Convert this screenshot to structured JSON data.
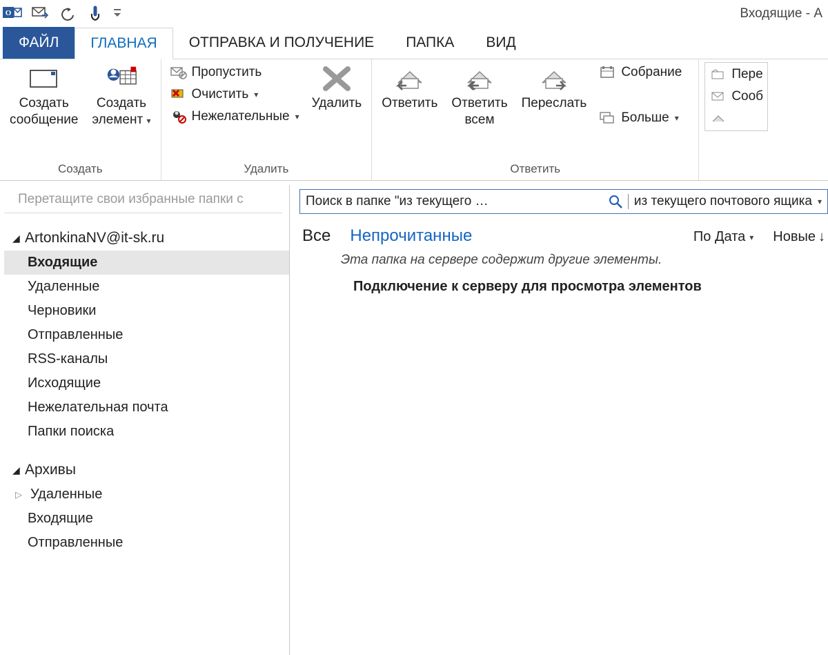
{
  "window_title": "Входящие - A",
  "tabs": {
    "file": "ФАЙЛ",
    "home": "ГЛАВНАЯ",
    "send_receive": "ОТПРАВКА И ПОЛУЧЕНИЕ",
    "folder": "ПАПКА",
    "view": "ВИД"
  },
  "ribbon": {
    "create": {
      "group_label": "Создать",
      "new_mail_top": "Создать",
      "new_mail_bottom": "сообщение",
      "new_item_top": "Создать",
      "new_item_bottom": "элемент"
    },
    "delete": {
      "group_label": "Удалить",
      "ignore": "Пропустить",
      "clean": "Очистить",
      "junk": "Нежелательные",
      "delete": "Удалить"
    },
    "respond": {
      "group_label": "Ответить",
      "reply": "Ответить",
      "reply_all_top": "Ответить",
      "reply_all_bottom": "всем",
      "forward": "Переслать",
      "meeting": "Собрание",
      "more": "Больше"
    },
    "quicksteps": {
      "item1": "Пере",
      "item2": "Сооб"
    }
  },
  "sidebar": {
    "favorites_hint": "Перетащите свои избранные папки с",
    "account": "ArtonkinaNV@it-sk.ru",
    "folders": {
      "inbox": "Входящие",
      "deleted": "Удаленные",
      "drafts": "Черновики",
      "sent": "Отправленные",
      "rss": "RSS-каналы",
      "outbox": "Исходящие",
      "junk": "Нежелательная почта",
      "search_folders": "Папки поиска"
    },
    "archives_label": "Архивы",
    "archives": {
      "deleted": "Удаленные",
      "inbox": "Входящие",
      "sent": "Отправленные"
    }
  },
  "main": {
    "search_placeholder": "Поиск в папке \"из текущего …",
    "search_scope": "из текущего почтового ящика",
    "filter_all": "Все",
    "filter_unread": "Непрочитанные",
    "sort_label": "По Дата",
    "order_label": "Новые",
    "server_hint": "Эта папка на сервере содержит другие элементы.",
    "connect_msg": "Подключение к серверу для просмотра элементов"
  }
}
